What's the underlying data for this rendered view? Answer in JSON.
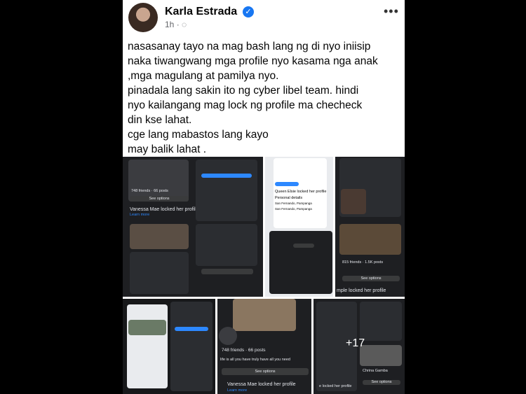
{
  "author": {
    "name": "Karla Estrada",
    "time": "1h",
    "privacy_icon": "globe-icon"
  },
  "body_lines": [
    "nasasanay tayo na mag bash lang ng di nyo iniisip",
    "naka tiwangwang mga profile nyo kasama nga anak",
    ",mga magulang at pamilya nyo.",
    "pinadala lang sakin ito ng cyber libel team. hindi",
    "nyo kailangang mag lock ng profile ma checheck",
    "din kse lahat.",
    "cge lang mabastos lang kayo",
    "may balik lahat ."
  ],
  "media": {
    "more_count": "+17",
    "tile1": {
      "friends": "748 friends · 66 posts",
      "see_options": "See options",
      "locked": "Vanessa Mae locked her profile",
      "learn": "Learn more"
    },
    "tile2": {
      "locked": "Queen Elsie locked her profile",
      "personal": "Personal details",
      "place1": "San Fernando, Pampanga",
      "place2": "San Fernando, Pampanga"
    },
    "tile3": {
      "see_options": "See options",
      "locked": "mple locked her profile",
      "friends": "815 friends · 1.5K posts"
    },
    "tile5": {
      "friends": "748 friends · 66 posts",
      "line": "life is all you have truly have all you need",
      "see_options": "See options",
      "locked": "Vanessa Mae locked her profile",
      "learn": "Learn more"
    },
    "tile6": {
      "name": "Chrina Gamba",
      "see_options": "See options",
      "locked": "e locked her profile"
    }
  },
  "colors": {
    "accent": "#1877f2",
    "dark_tile": "#1e1f22",
    "button": "#3a3b3c"
  }
}
